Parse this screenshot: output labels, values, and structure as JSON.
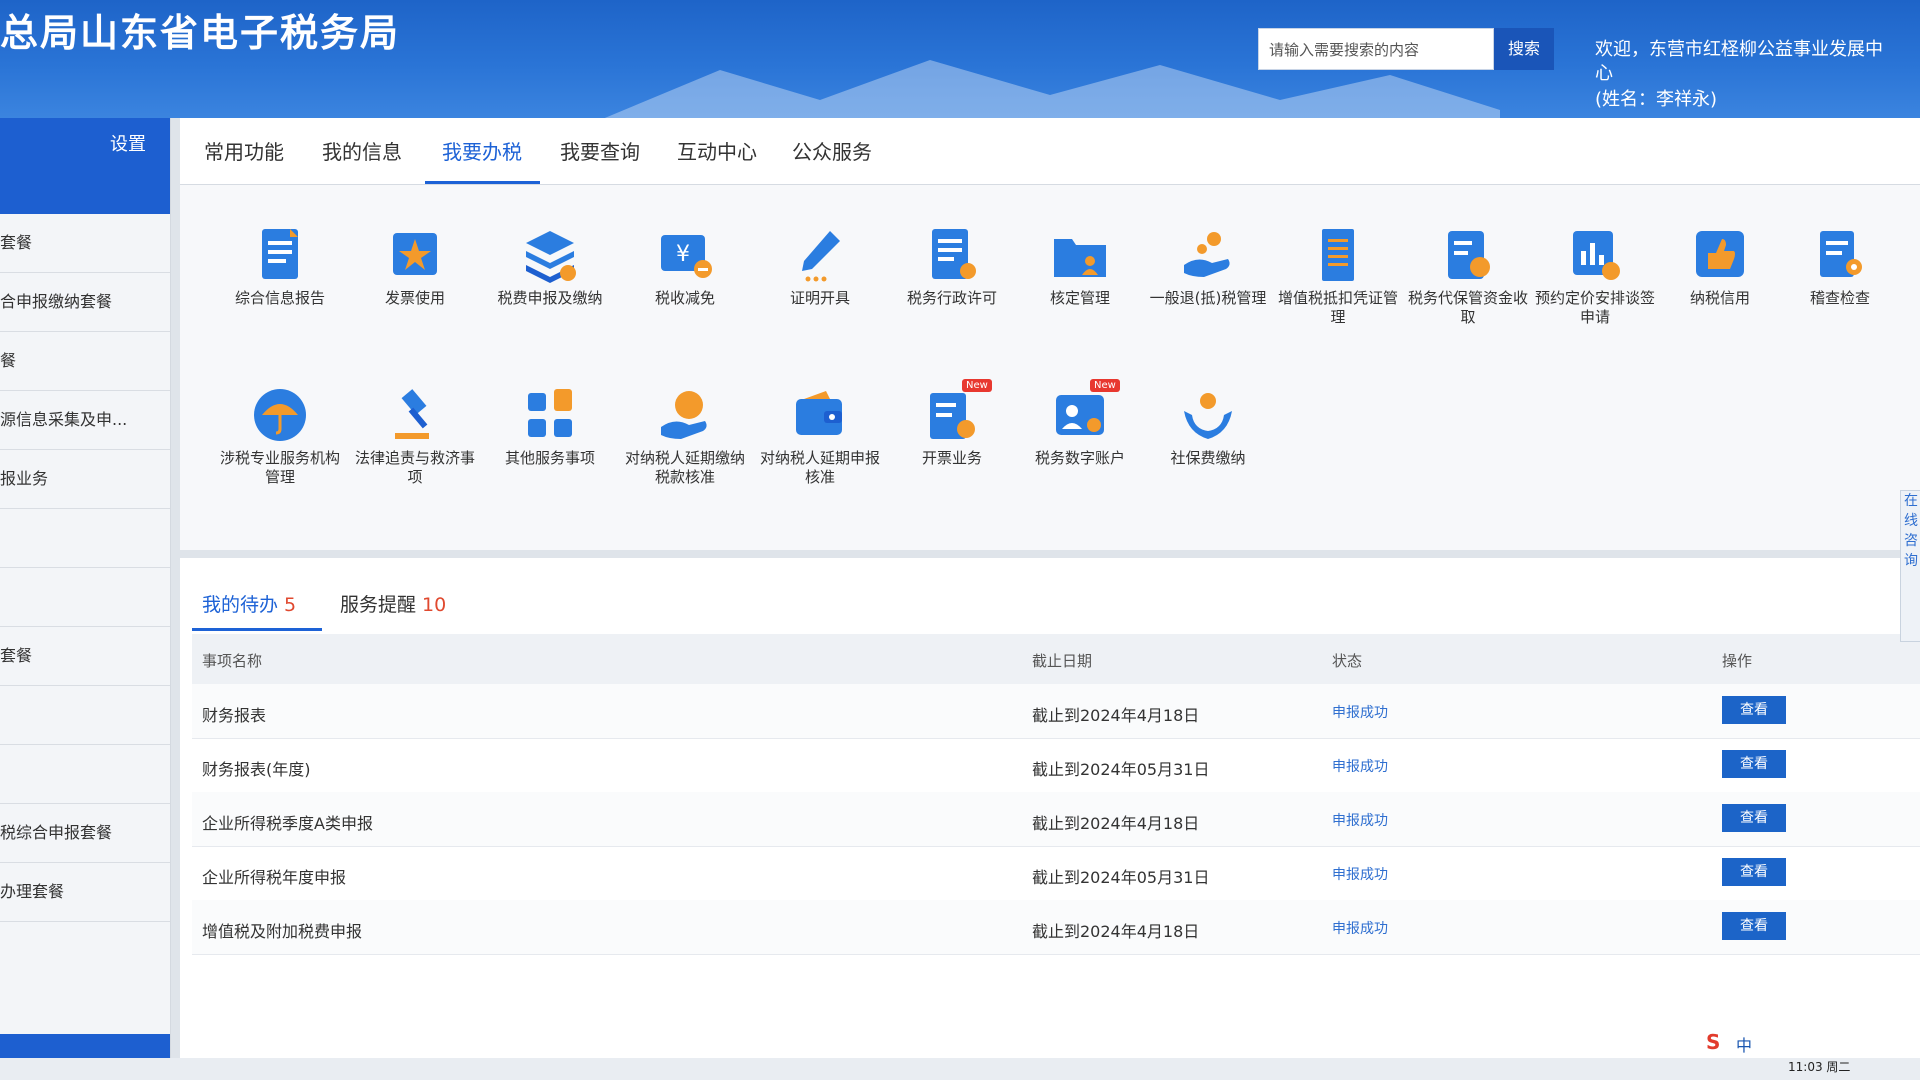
{
  "header": {
    "title": "总局山东省电子税务局",
    "search_placeholder": "请输入需要搜索的内容",
    "search_button": "搜索",
    "welcome_text": "欢迎，东营市红柽柳公益事业发展中心",
    "user_name": "(姓名：李祥永)"
  },
  "sidebar": {
    "settings": "设置",
    "items": [
      "套餐",
      "合申报缴纳套餐",
      "餐",
      "源信息采集及申...",
      "报业务",
      "",
      "",
      "套餐",
      "",
      "",
      "税综合申报套餐",
      "办理套餐"
    ]
  },
  "tabs": [
    "常用功能",
    "我的信息",
    "我要办税",
    "我要查询",
    "互动中心",
    "公众服务"
  ],
  "active_tab": "我要办税",
  "services": [
    {
      "label": "综合信息报告",
      "icon": "report-doc-icon"
    },
    {
      "label": "发票使用",
      "icon": "invoice-star-icon"
    },
    {
      "label": "税费申报及缴纳",
      "icon": "stack-layers-icon"
    },
    {
      "label": "税收减免",
      "icon": "yuan-discount-icon"
    },
    {
      "label": "证明开具",
      "icon": "pen-icon"
    },
    {
      "label": "税务行政许可",
      "icon": "license-doc-icon"
    },
    {
      "label": "核定管理",
      "icon": "folder-person-icon"
    },
    {
      "label": "一般退(抵)税管理",
      "icon": "hand-coin-icon"
    },
    {
      "label": "增值税抵扣凭证管理",
      "icon": "voucher-icon"
    },
    {
      "label": "税务代保管资金收取",
      "icon": "fund-custody-icon"
    },
    {
      "label": "预约定价安排谈签申请",
      "icon": "pricing-chart-icon"
    },
    {
      "label": "纳税信用",
      "icon": "thumbs-up-icon"
    },
    {
      "label": "稽查检查",
      "icon": "inspection-icon"
    },
    {
      "label": "涉税专业服务机构管理",
      "icon": "umbrella-icon"
    },
    {
      "label": "法律追责与救济事项",
      "icon": "gavel-icon"
    },
    {
      "label": "其他服务事项",
      "icon": "grid-blocks-icon"
    },
    {
      "label": "对纳税人延期缴纳税款核准",
      "icon": "deferral-payment-icon"
    },
    {
      "label": "对纳税人延期申报核准",
      "icon": "wallet-icon"
    },
    {
      "label": "开票业务",
      "icon": "invoicing-icon",
      "badge": "New"
    },
    {
      "label": "税务数字账户",
      "icon": "digital-account-icon",
      "badge": "New"
    },
    {
      "label": "社保费缴纳",
      "icon": "social-security-icon"
    }
  ],
  "todo": {
    "tabs": [
      {
        "label": "我的待办",
        "count": "5"
      },
      {
        "label": "服务提醒",
        "count": "10"
      }
    ],
    "columns": [
      "事项名称",
      "截止日期",
      "状态",
      "操作"
    ],
    "rows": [
      {
        "name": "财务报表",
        "deadline": "截止到2024年4月18日",
        "status": "申报成功",
        "action": "查看"
      },
      {
        "name": "财务报表(年度)",
        "deadline": "截止到2024年05月31日",
        "status": "申报成功",
        "action": "查看"
      },
      {
        "name": "企业所得税季度A类申报",
        "deadline": "截止到2024年4月18日",
        "status": "申报成功",
        "action": "查看"
      },
      {
        "name": "企业所得税年度申报",
        "deadline": "截止到2024年05月31日",
        "status": "申报成功",
        "action": "查看"
      },
      {
        "name": "增值税及附加税费申报",
        "deadline": "截止到2024年4月18日",
        "status": "申报成功",
        "action": "查看"
      }
    ]
  },
  "right_float_text": "在线咨询",
  "taskbar": {
    "ime": "S",
    "lang": "中",
    "time": "11:03 周二"
  },
  "colors": {
    "primary": "#1d62d6",
    "header": "#2a74d6",
    "accent_orange": "#f39a2b",
    "badge_red": "#e8382f"
  }
}
